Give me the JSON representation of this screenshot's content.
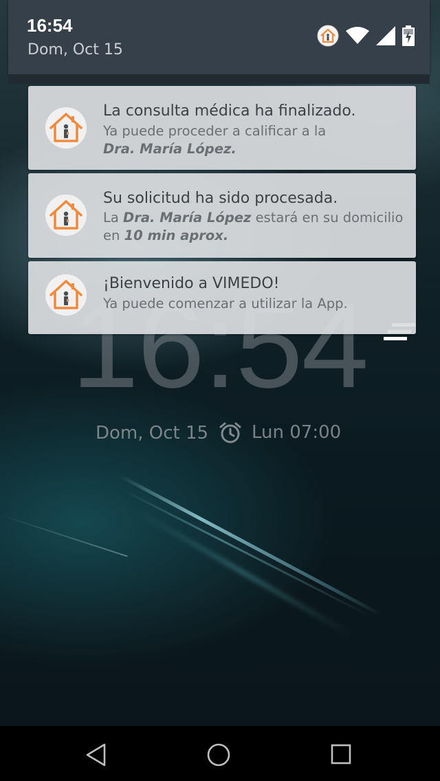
{
  "status_bar": {
    "time": "16:54",
    "date": "Dom, Oct 15",
    "icons": [
      "vimedo-app-icon",
      "wifi-icon",
      "signal-icon",
      "battery-charging-icon"
    ]
  },
  "notifications": [
    {
      "app": "VIMEDO",
      "icon": "house-doctor-icon",
      "title": "La consulta médica ha finalizado.",
      "body_prefix": "Ya puede proceder a calificar a la",
      "body_emphasis": "Dra. María López."
    },
    {
      "app": "VIMEDO",
      "icon": "house-doctor-icon",
      "title": "Su solicitud ha sido procesada.",
      "body_part1": "La",
      "body_emphasis1": "Dra. María López",
      "body_part2": "estará en su domicilio en",
      "body_emphasis2": "10 min aprox."
    },
    {
      "app": "VIMEDO",
      "icon": "house-doctor-icon",
      "title": "¡Bienvenido a VIMEDO!",
      "body": "Ya puede comenzar a utilizar la App."
    }
  ],
  "lock_screen": {
    "clock": "16:54",
    "date": "Dom, Oct 15",
    "alarm": "Lun 07:00"
  },
  "navigation": {
    "back_icon": "back-triangle-icon",
    "home_icon": "home-circle-icon",
    "recents_icon": "recents-square-icon"
  },
  "colors": {
    "accent_orange": "#f28a3c",
    "card_background": "#dadddf",
    "shade_header": "#36404a"
  }
}
